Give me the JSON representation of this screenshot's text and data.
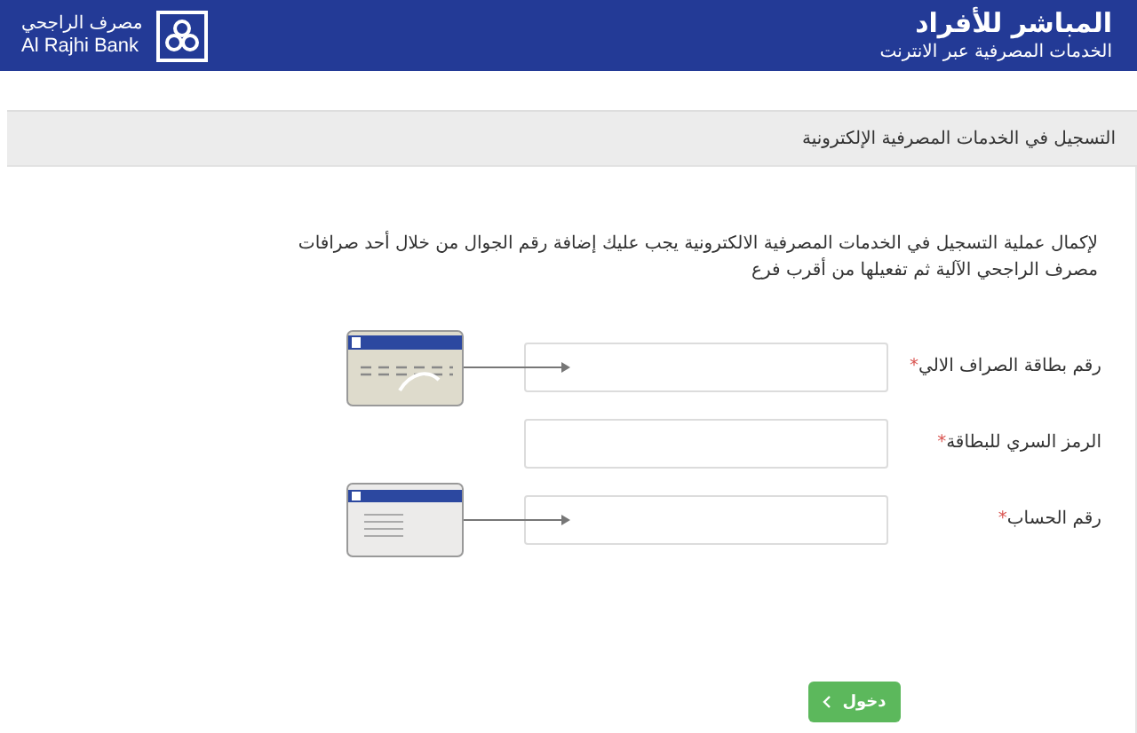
{
  "header": {
    "title": "المباشر للأفراد",
    "subtitle": "الخدمات المصرفية عبر الانترنت",
    "bank_name_arabic": "مصرف الراجحي",
    "bank_name_english": "Al Rajhi Bank"
  },
  "section": {
    "heading": "التسجيل في الخدمات المصرفية الإلكترونية"
  },
  "intro_lines": [
    "لإكمال عملية التسجيل في الخدمات المصرفية الالكترونية يجب عليك إضافة رقم الجوال من خلال أحد صرافات",
    "مصرف الراجحي الآلية ثم تفعيلها من أقرب فرع"
  ],
  "fields": [
    {
      "label": "رقم بطاقة الصراف الالي",
      "required_mark": "*",
      "kind": "front"
    },
    {
      "label": "الرمز السري للبطاقة",
      "required_mark": "*",
      "kind": "plain"
    },
    {
      "label": "رقم الحساب",
      "required_mark": "*",
      "kind": "back"
    }
  ],
  "submit_button": {
    "label": "دخول"
  }
}
